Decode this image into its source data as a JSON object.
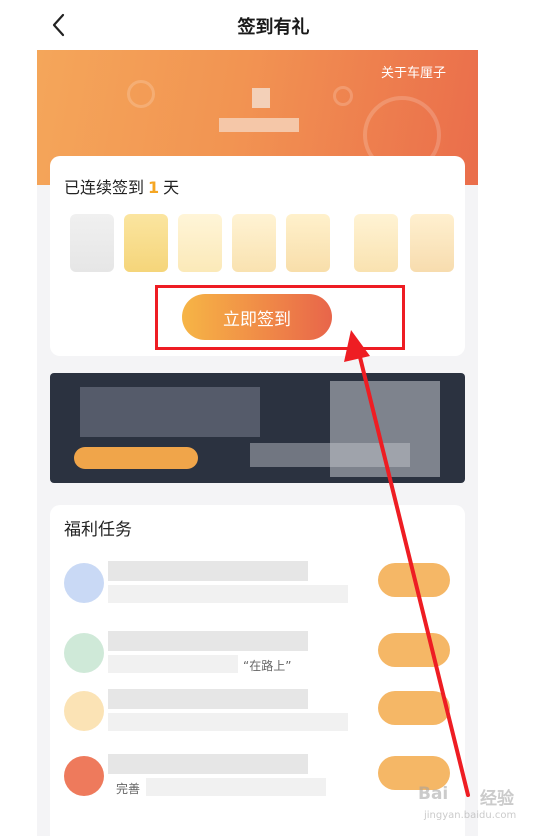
{
  "header": {
    "title": "签到有礼"
  },
  "banner": {
    "about_link": "关于车厘子"
  },
  "checkin": {
    "streak_prefix": "已连续签到",
    "streak_days": "1",
    "streak_suffix": "天",
    "button_label": "立即签到"
  },
  "tasks": {
    "title": "福利任务",
    "row2_partial": "“在路上”",
    "row4_partial": "完善"
  },
  "watermark": {
    "brand": "Bai",
    "brand_cn": "经验",
    "url": "jingyan.baidu.com"
  },
  "colors": {
    "accent": "#f5a623",
    "button_start": "#f6b546",
    "button_end": "#e8654a",
    "annotation": "#ee1d23"
  }
}
